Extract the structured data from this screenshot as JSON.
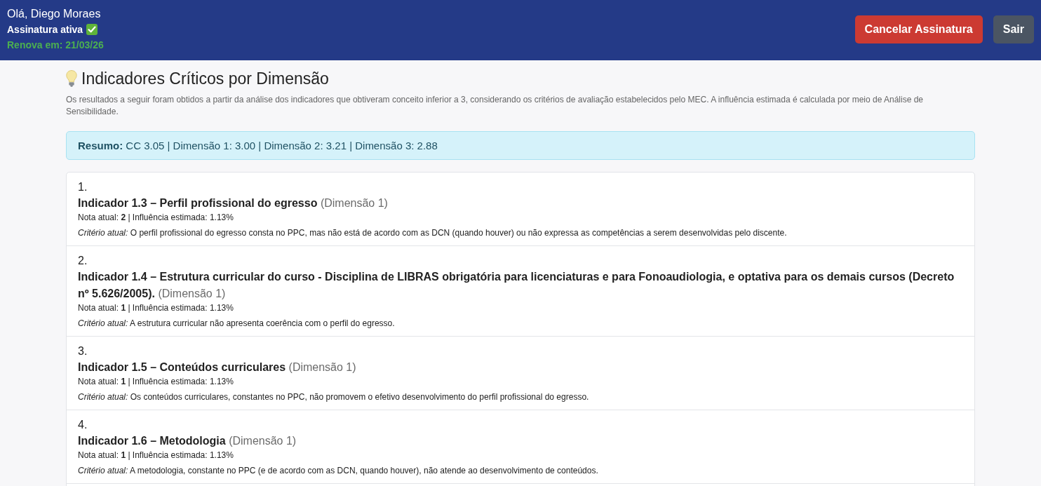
{
  "header": {
    "greeting": "Olá, Diego Moraes",
    "subscription_status": "Assinatura ativa",
    "renewal": "Renova em: 21/03/26",
    "buttons": [
      {
        "label": "Cancelar Assinatura",
        "kind": "danger"
      },
      {
        "label": "Sair",
        "kind": "secondary"
      }
    ]
  },
  "section": {
    "title": "Indicadores Críticos por Dimensão",
    "description": "Os resultados a seguir foram obtidos a partir da análise dos indicadores que obtiveram conceito inferior a 3, considerando os critérios de avaliação estabelecidos pelo MEC. A influência estimada é calculada por meio de Análise de Sensibilidade.",
    "summary": "**Resumo:** CC 3.05 | Dimensão 1: 3.00 | Dimensão 2: 3.21 | Dimensão 3: 2.88"
  },
  "indicators": [
    {
      "number": "1.",
      "title": "Indicador 1.3 – Perfil profissional do egresso",
      "dimension": "(Dimensão 1)",
      "score": "Nota atual: **2** | Influência estimada: 1.13%",
      "criterion": "*Critério atual:* O perfil profissional do egresso consta no PPC, mas não está de acordo com as DCN (quando houver) ou não expressa as competências a serem desenvolvidas pelo discente."
    },
    {
      "number": "2.",
      "title": "Indicador 1.4 – Estrutura curricular do curso - Disciplina de LIBRAS obrigatória para licenciaturas e para Fonoaudiologia, e optativa para os demais cursos (Decreto nº 5.626/2005).",
      "dimension": "(Dimensão 1)",
      "score": "Nota atual: **1** | Influência estimada: 1.13%",
      "criterion": "*Critério atual:* A estrutura curricular não apresenta coerência com o perfil do egresso."
    },
    {
      "number": "3.",
      "title": "Indicador 1.5 – Conteúdos curriculares",
      "dimension": "(Dimensão 1)",
      "score": "Nota atual: **1** | Influência estimada: 1.13%",
      "criterion": "*Critério atual:* Os conteúdos curriculares, constantes no PPC, não promovem o efetivo desenvolvimento do perfil profissional do egresso."
    },
    {
      "number": "4.",
      "title": "Indicador 1.6 – Metodologia",
      "dimension": "(Dimensão 1)",
      "score": "Nota atual: **1** | Influência estimada: 1.13%",
      "criterion": "*Critério atual:* A metodologia, constante no PPC (e de acordo com as DCN, quando houver), não atende ao desenvolvimento de conteúdos."
    }
  ]
}
